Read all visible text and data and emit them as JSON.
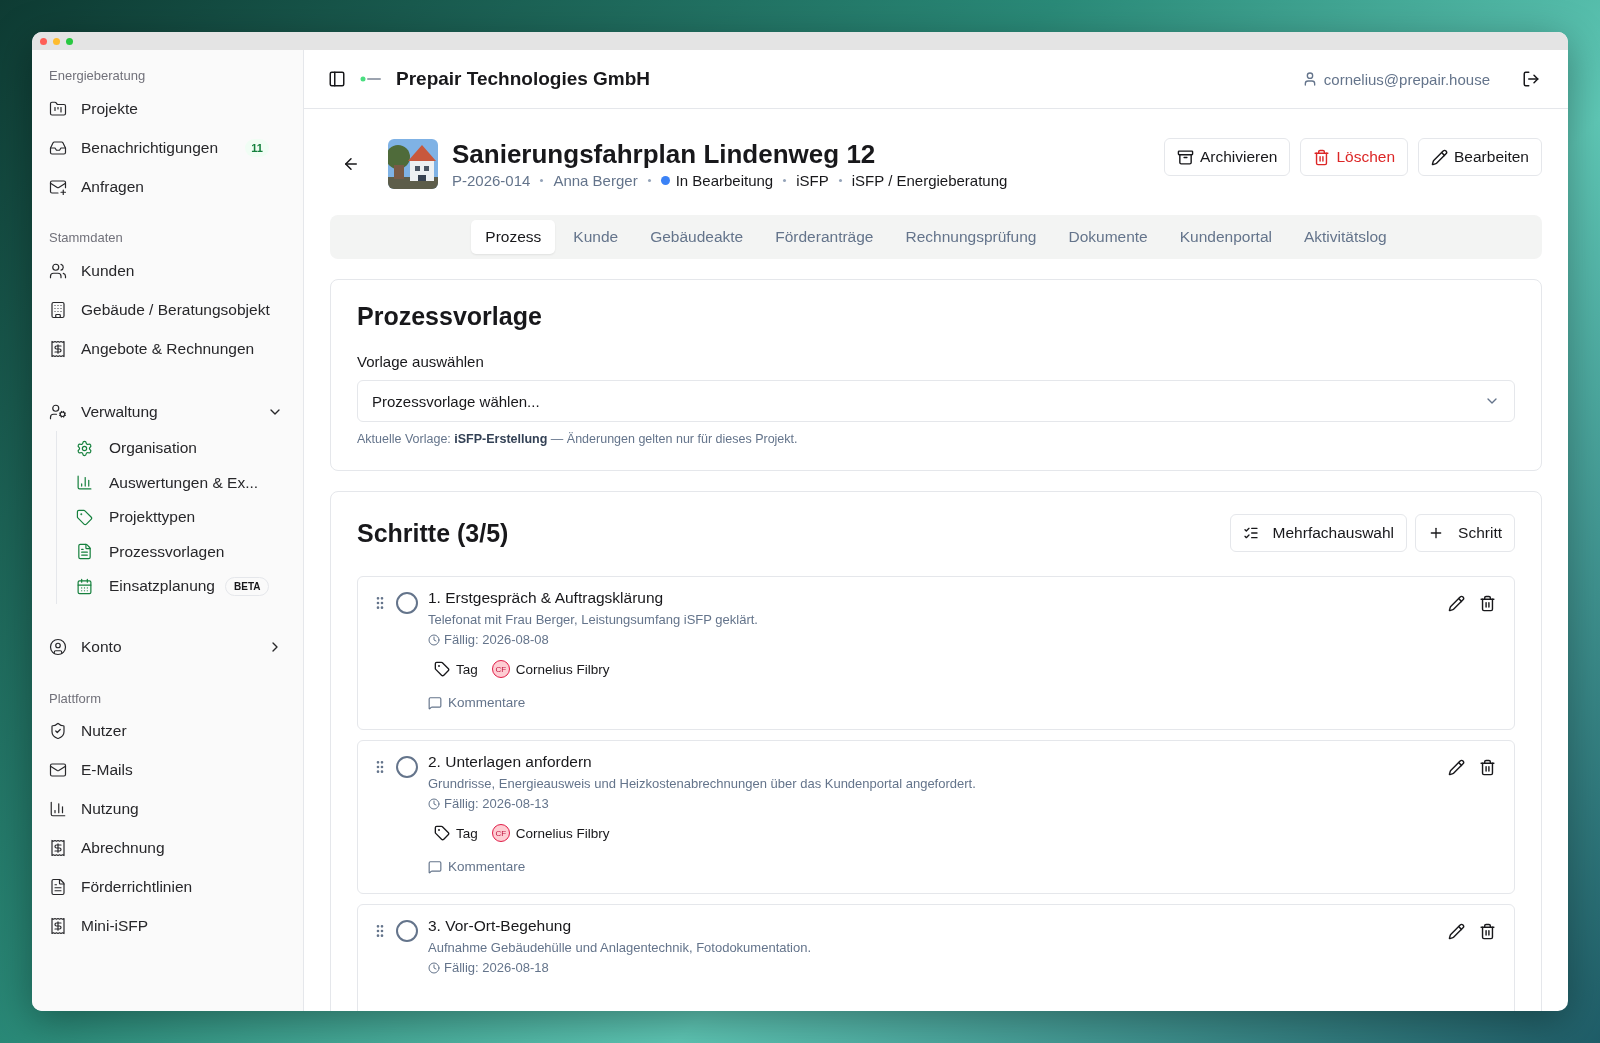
{
  "sidebar": {
    "sections": [
      {
        "heading": "Energieberatung",
        "items": [
          {
            "label": "Projekte"
          },
          {
            "label": "Benachrichtigungen",
            "badge": "11"
          },
          {
            "label": "Anfragen"
          }
        ]
      },
      {
        "heading": "Stammdaten",
        "items": [
          {
            "label": "Kunden"
          },
          {
            "label": "Gebäude / Beratungsobjekt"
          },
          {
            "label": "Angebote & Rechnungen"
          }
        ]
      },
      {
        "items": [
          {
            "label": "Verwaltung",
            "expanded": true,
            "children": [
              {
                "label": "Organisation"
              },
              {
                "label": "Auswertungen & Ex..."
              },
              {
                "label": "Projekttypen"
              },
              {
                "label": "Prozessvorlagen"
              },
              {
                "label": "Einsatzplanung",
                "badge": "BETA"
              }
            ]
          }
        ]
      },
      {
        "items": [
          {
            "label": "Konto",
            "expanded": false
          }
        ]
      },
      {
        "heading": "Plattform",
        "items": [
          {
            "label": "Nutzer"
          },
          {
            "label": "E-Mails"
          },
          {
            "label": "Nutzung"
          },
          {
            "label": "Abrechnung"
          },
          {
            "label": "Förderrichtlinien"
          },
          {
            "label": "Mini-iSFP"
          }
        ]
      }
    ]
  },
  "header": {
    "organization": "Prepair Technologies GmbH",
    "user": "cornelius@prepair.house"
  },
  "project": {
    "title": "Sanierungsfahrplan Lindenweg 12",
    "meta": [
      {
        "text": "P-2026-014",
        "kind": "plain"
      },
      {
        "text": "Anna Berger",
        "kind": "plain"
      },
      {
        "text": "In Bearbeitung",
        "kind": "status",
        "color": "#3b82f6"
      },
      {
        "text": "iSFP",
        "kind": "strong"
      },
      {
        "text": "iSFP / Energieberatung",
        "kind": "strong"
      }
    ],
    "actions": [
      {
        "label": "Archivieren",
        "kind": "archive"
      },
      {
        "label": "Löschen",
        "kind": "delete"
      },
      {
        "label": "Bearbeiten",
        "kind": "edit"
      }
    ]
  },
  "tabs": [
    {
      "label": "Prozess",
      "selected": true
    },
    {
      "label": "Kunde",
      "selected": false
    },
    {
      "label": "Gebäudeakte",
      "selected": false
    },
    {
      "label": "Förderanträge",
      "selected": false
    },
    {
      "label": "Rechnungsprüfung",
      "selected": false
    },
    {
      "label": "Dokumente",
      "selected": false
    },
    {
      "label": "Kundenportal",
      "selected": false
    },
    {
      "label": "Aktivitätslog",
      "selected": false
    }
  ],
  "template": {
    "title": "Prozessvorlage",
    "label": "Vorlage auswählen",
    "placeholder": "Prozessvorlage wählen...",
    "note": "Aktuelle Vorlage: **iSFP-Erstellung** — Änderungen gelten nur für dieses Projekt."
  },
  "steps": {
    "title": "Schritte (3/5)",
    "actions": [
      {
        "label": "Mehrfachauswahl",
        "kind": "multi"
      },
      {
        "label": "Schritt",
        "kind": "add"
      }
    ],
    "items": [
      {
        "title": "1. Erstgespräch & Auftragsklärung",
        "description": "Telefonat mit Frau Berger, Leistungsumfang iSFP geklärt.",
        "due": "Fällig: 2026-08-08",
        "checked": false,
        "tag": "Tag",
        "initials": "CF",
        "assignee": "Cornelius Filbry",
        "comments": "Kommentare"
      },
      {
        "title": "2. Unterlagen anfordern",
        "description": "Grundrisse, Energieausweis und Heizkostenabrechnungen über das Kundenportal angefordert.",
        "due": "Fällig: 2026-08-13",
        "checked": false,
        "tag": "Tag",
        "initials": "CF",
        "assignee": "Cornelius Filbry",
        "comments": "Kommentare"
      },
      {
        "title": "3. Vor-Ort-Begehung",
        "description": "Aufnahme Gebäudehülle und Anlagentechnik, Fotodokumentation.",
        "due": "Fällig: 2026-08-18",
        "checked": false
      }
    ]
  }
}
